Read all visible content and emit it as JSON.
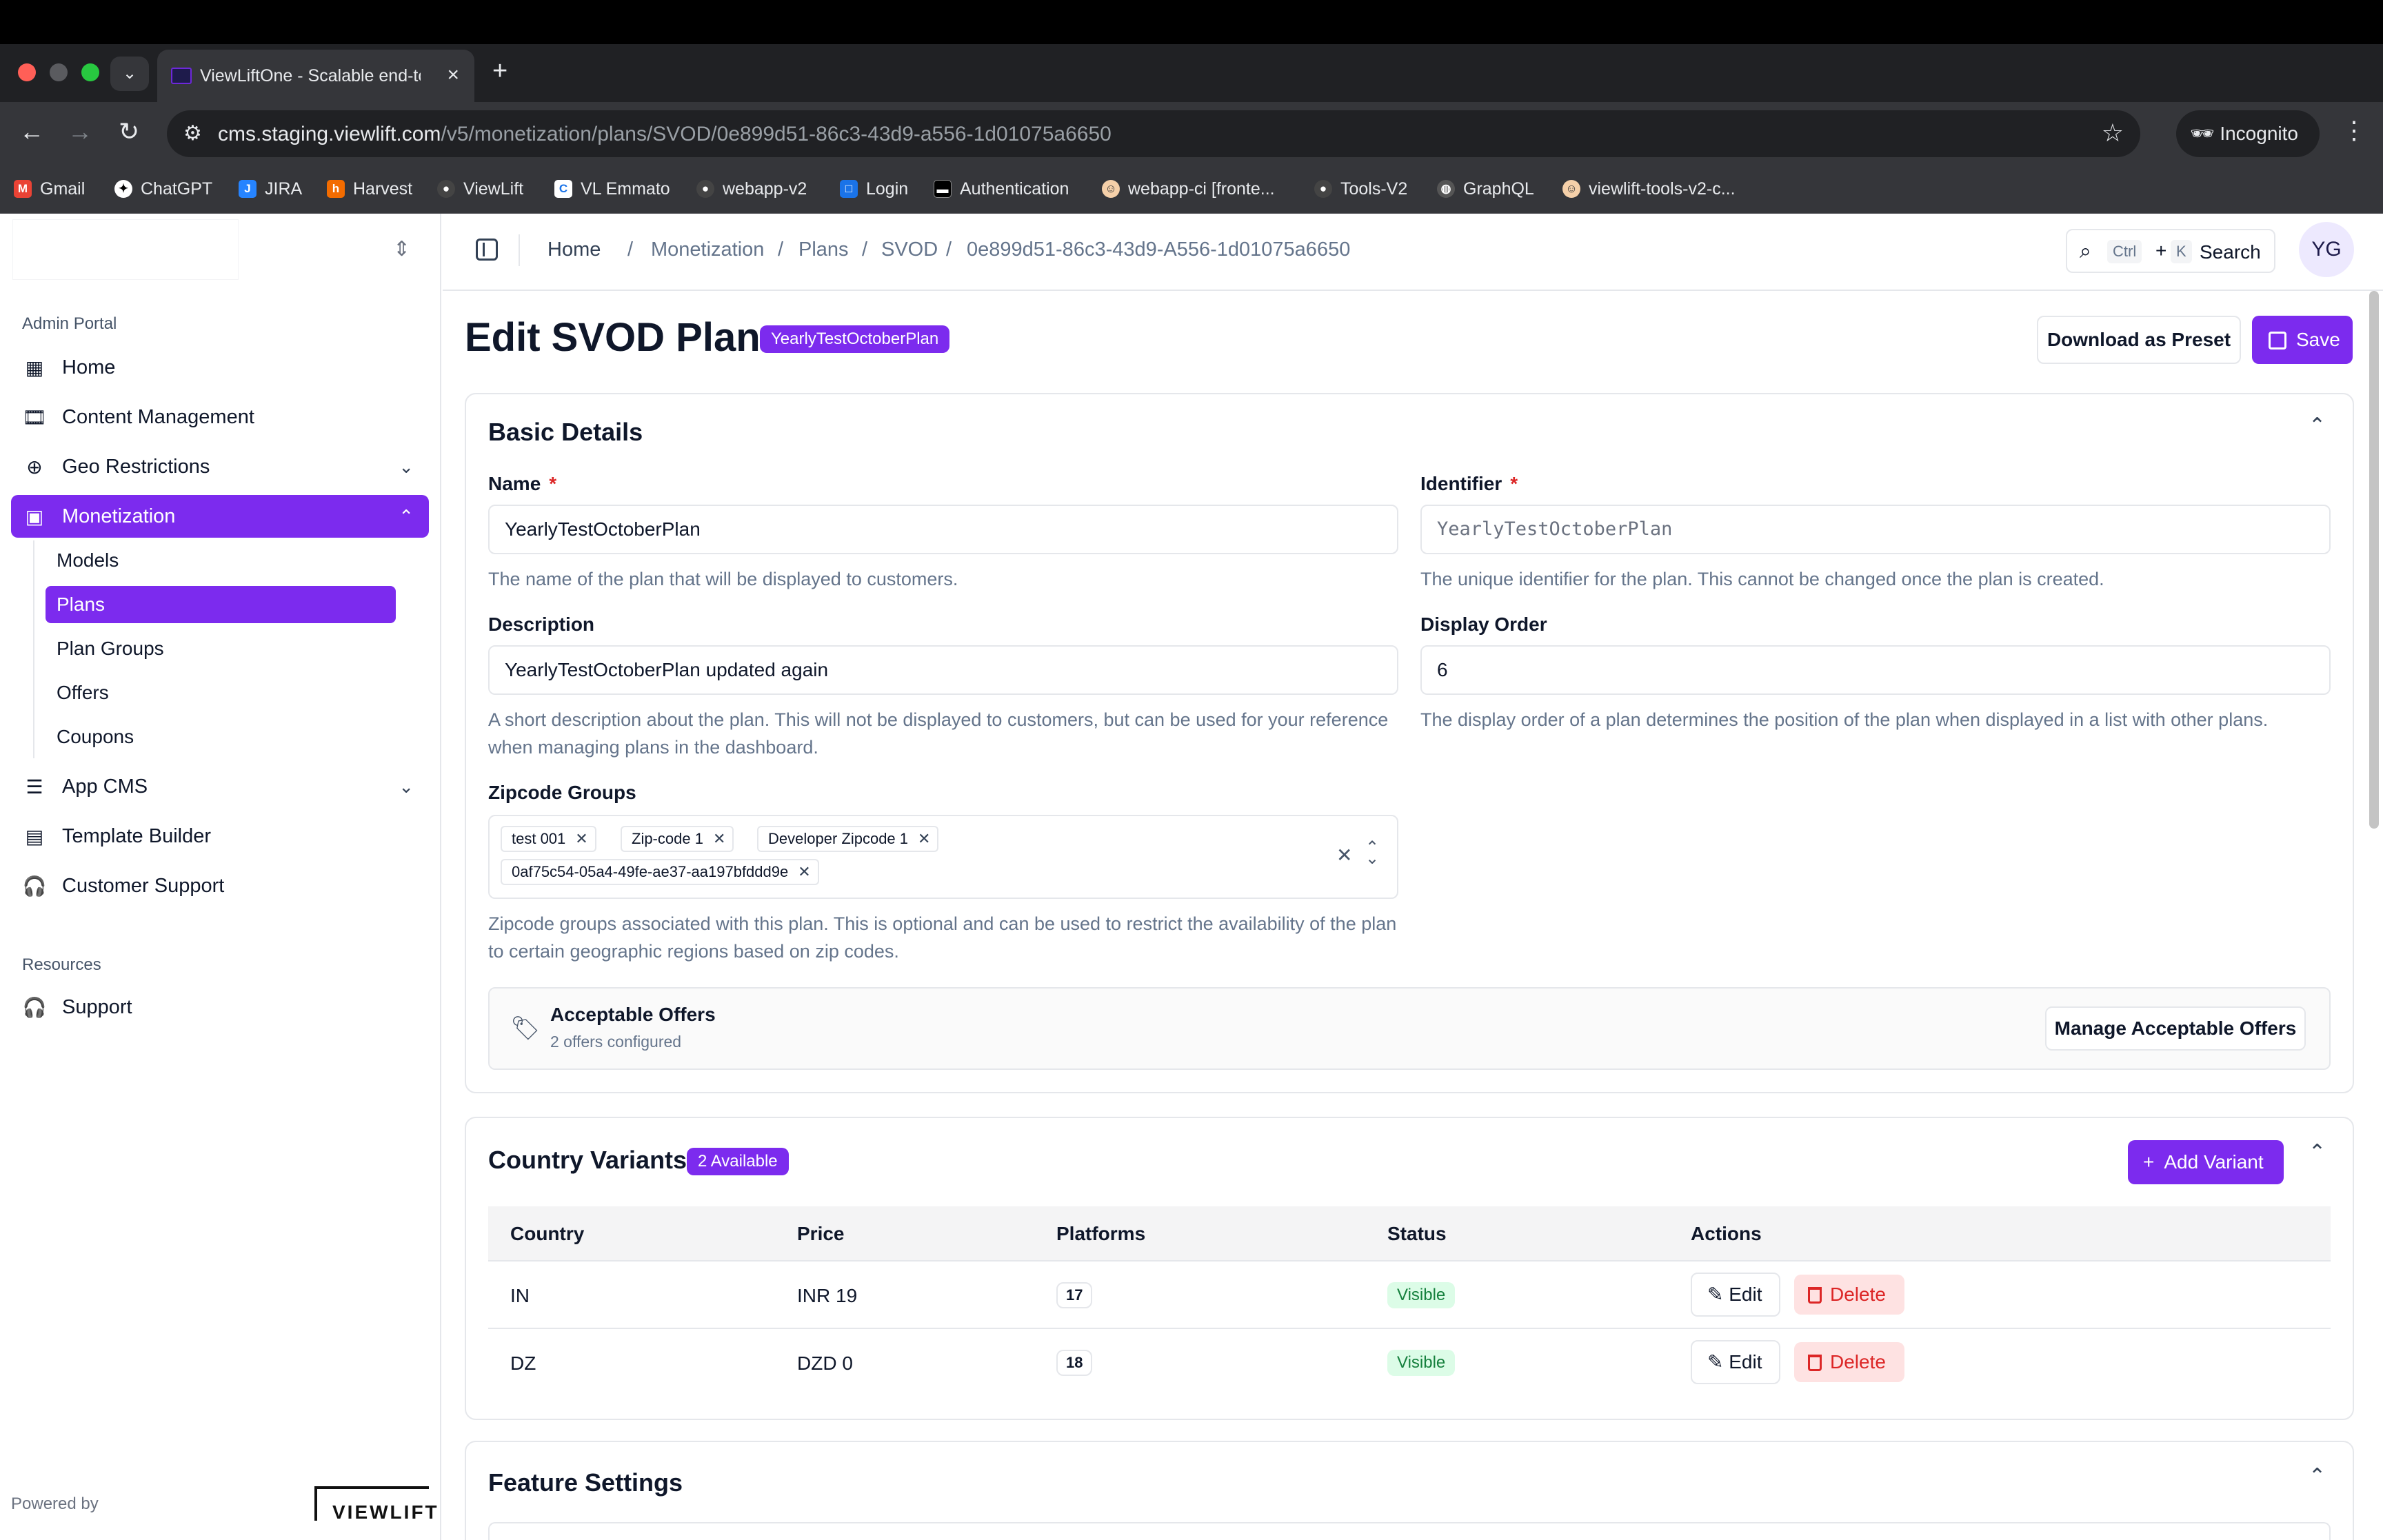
{
  "browser": {
    "active_tab_title": "ViewLiftOne - Scalable end-to-end OTT",
    "url_host": "cms.staging.viewlift.com",
    "url_path": "/v5/monetization/plans/SVOD/0e899d51-86c3-43d9-a556-1d01075a6650",
    "incognito_label": "Incognito",
    "bookmarks": [
      "Gmail",
      "ChatGPT",
      "JIRA",
      "Harvest",
      "ViewLift",
      "VL Emmato",
      "webapp-v2",
      "Login",
      "Authentication",
      "webapp-ci [fronte...",
      "Tools-V2",
      "GraphQL",
      "viewlift-tools-v2-c..."
    ]
  },
  "sidebar": {
    "section_admin": "Admin Portal",
    "items": [
      {
        "label": "Home",
        "icon": "dashboard-icon"
      },
      {
        "label": "Content Management",
        "icon": "film-icon"
      },
      {
        "label": "Geo Restrictions",
        "icon": "globe-icon"
      },
      {
        "label": "Monetization",
        "icon": "wallet-icon"
      },
      {
        "label": "App CMS",
        "icon": "sliders-icon"
      },
      {
        "label": "Template Builder",
        "icon": "layout-icon"
      },
      {
        "label": "Customer Support",
        "icon": "headset-icon"
      }
    ],
    "monetization_children": [
      "Models",
      "Plans",
      "Plan Groups",
      "Offers",
      "Coupons"
    ],
    "section_resources": "Resources",
    "resources": [
      {
        "label": "Support",
        "icon": "headset-icon"
      }
    ],
    "powered_by": "Powered by",
    "brand": "VIEWLIFT"
  },
  "header": {
    "breadcrumbs": [
      "Home",
      "Monetization",
      "Plans",
      "SVOD",
      "0e899d51-86c3-43d9-A556-1d01075a6650"
    ],
    "search": {
      "key1": "Ctrl",
      "plus": "+",
      "key2": "K",
      "label": "Search"
    },
    "avatar_initials": "YG"
  },
  "page": {
    "title": "Edit SVOD Plan",
    "badge": "YearlyTestOctoberPlan",
    "download_preset_label": "Download as Preset",
    "save_label": "Save"
  },
  "basic_details": {
    "title": "Basic Details",
    "name": {
      "label": "Name",
      "value": "YearlyTestOctoberPlan",
      "help": "The name of the plan that will be displayed to customers."
    },
    "identifier": {
      "label": "Identifier",
      "value": "YearlyTestOctoberPlan",
      "help": "The unique identifier for the plan. This cannot be changed once the plan is created."
    },
    "description": {
      "label": "Description",
      "value": "YearlyTestOctoberPlan updated again",
      "help": "A short description about the plan. This will not be displayed to customers, but can be used for your reference when managing plans in the dashboard."
    },
    "display_order": {
      "label": "Display Order",
      "value": "6",
      "help": "The display order of a plan determines the position of the plan when displayed in a list with other plans."
    },
    "zipcode_groups": {
      "label": "Zipcode Groups",
      "chips": [
        "test 001",
        "Zip-code 1",
        "Developer Zipcode 1",
        "0af75c54-05a4-49fe-ae37-aa197bfddd9e"
      ],
      "help": "Zipcode groups associated with this plan. This is optional and can be used to restrict the availability of the plan to certain geographic regions based on zip codes."
    },
    "acceptable_offers": {
      "title": "Acceptable Offers",
      "subtitle": "2 offers configured",
      "button": "Manage Acceptable Offers"
    }
  },
  "country_variants": {
    "title": "Country Variants",
    "badge": "2 Available",
    "add_label": "Add Variant",
    "columns": [
      "Country",
      "Price",
      "Platforms",
      "Status",
      "Actions"
    ],
    "rows": [
      {
        "country": "IN",
        "price": "INR 19",
        "platforms": "17",
        "status": "Visible"
      },
      {
        "country": "DZ",
        "price": "DZD 0",
        "platforms": "18",
        "status": "Visible"
      }
    ],
    "edit_label": "Edit",
    "delete_label": "Delete"
  },
  "feature_settings": {
    "title": "Feature Settings"
  },
  "colors": {
    "accent": "#7c2bee",
    "status_visible": "#15803d",
    "danger": "#dc2626"
  }
}
